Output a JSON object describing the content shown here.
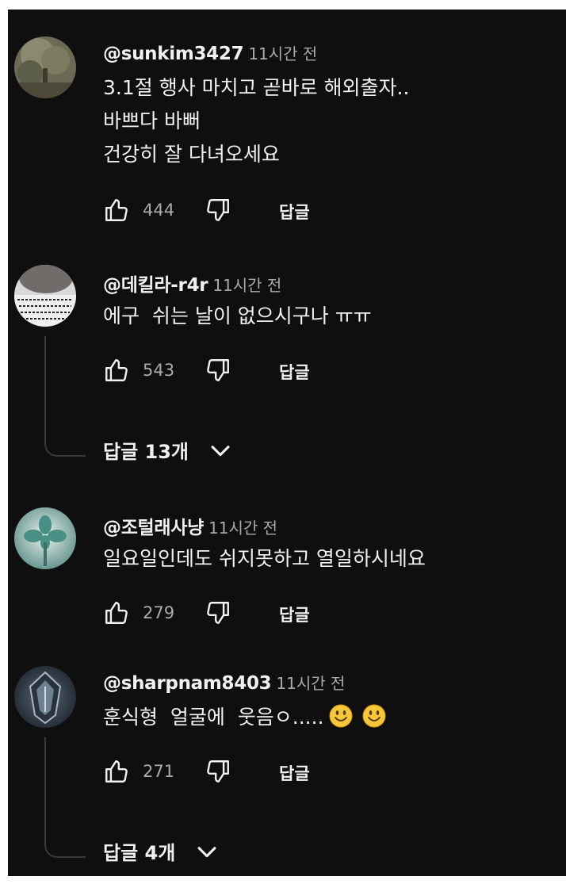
{
  "comments": [
    {
      "author": "@sunkim3427",
      "time": "11시간 전",
      "lines": [
        "3.1절 행사 마치고 곧바로 해외출자..",
        "바쁘다 바뻐",
        "건강히 잘 다녀오세요"
      ],
      "likes": "444",
      "reply_label": "답글",
      "avatar_icon": "avatar-tree-photo"
    },
    {
      "author": "@데킬라-r4r",
      "time": "11시간 전",
      "lines": [
        "에구  쉬는 날이 없으시구나 ㅠㅠ"
      ],
      "likes": "543",
      "reply_label": "답글",
      "replies_toggle": "답글 13개",
      "avatar_icon": "avatar-face-photo"
    },
    {
      "author": "@조털래사냥",
      "time": "11시간 전",
      "lines": [
        "일요일인데도 쉬지못하고 열일하시네요"
      ],
      "likes": "279",
      "reply_label": "답글",
      "avatar_icon": "avatar-clover-logo"
    },
    {
      "author": "@sharpnam8403",
      "time": "11시간 전",
      "lines": [
        "훈식형  얼굴에  웃음ㅇ....."
      ],
      "emojis": [
        "smiling-face-emoji",
        "smiling-face-emoji"
      ],
      "likes": "271",
      "reply_label": "답글",
      "replies_toggle": "답글 4개",
      "avatar_icon": "avatar-crest-logo"
    }
  ],
  "icons": {
    "like": "thumbs-up-icon",
    "dislike": "thumbs-down-icon",
    "expand": "chevron-down-icon"
  },
  "colors": {
    "background": "#0f0f0f",
    "text_primary": "#f1f1f1",
    "text_secondary": "#aaaaaa"
  }
}
